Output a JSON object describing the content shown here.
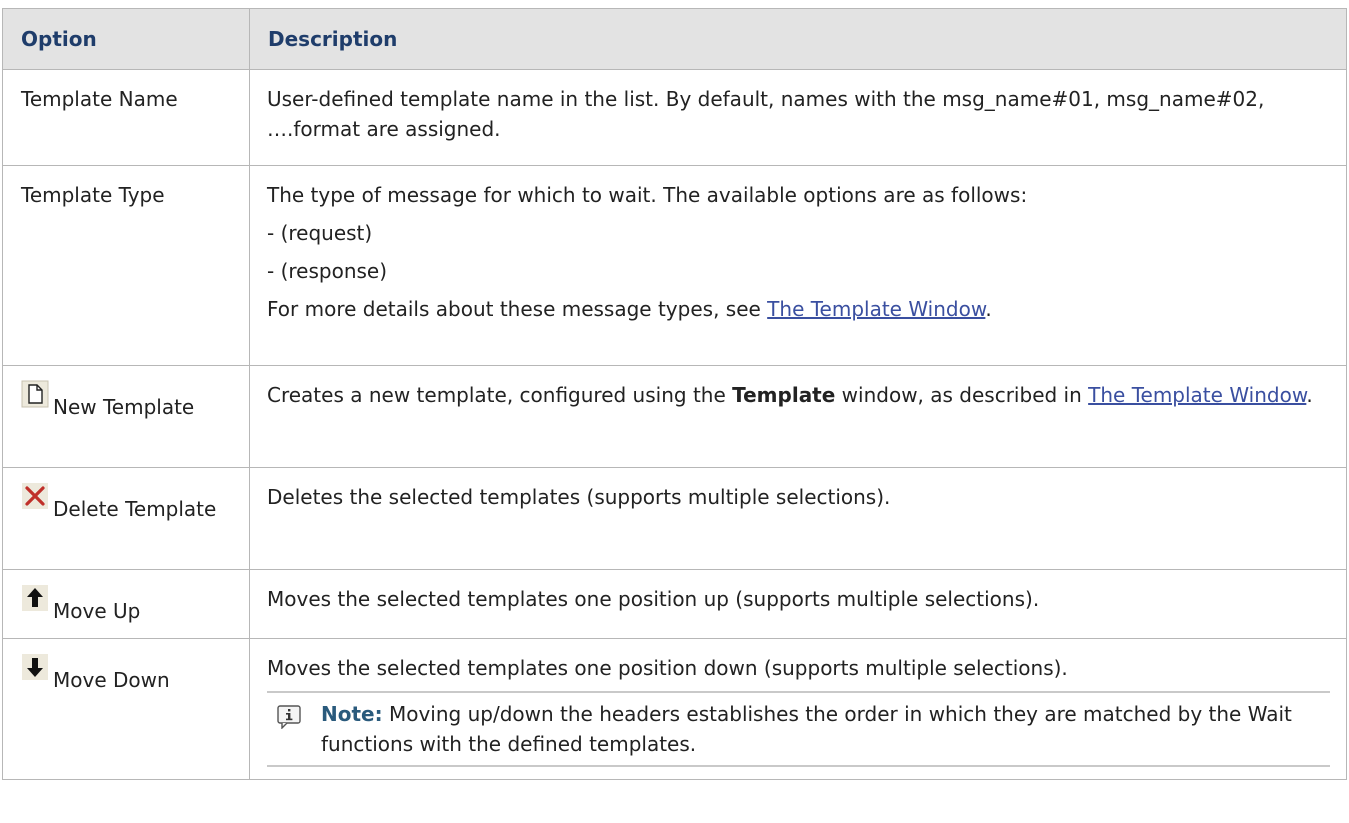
{
  "table": {
    "headers": {
      "option": "Option",
      "description": "Description"
    },
    "rows": [
      {
        "option": "Template Name",
        "desc": [
          "User-defined template name in the list. By default, names with the msg_name#01, msg_name#02, ….format are assigned."
        ]
      },
      {
        "option": "Template Type",
        "desc": [
          "The type of message for which to wait. The available options are as follows:",
          "- (request)",
          "- (response)"
        ],
        "more_prefix": "For more details about these message types, see ",
        "link": "The Template Window",
        "more_suffix": "."
      },
      {
        "icon": "new-document-icon",
        "option": "New Template",
        "desc_prefix": "Creates a new template, configured using the ",
        "desc_bold": "Template",
        "desc_suffix": " window, as described in ",
        "link": "The Template Window",
        "link_suffix": "."
      },
      {
        "icon": "red-x-delete-icon",
        "option": "Delete Template",
        "desc": [
          "Deletes the selected templates (supports multiple selections)."
        ]
      },
      {
        "icon": "up-arrow-icon",
        "option": "Move Up",
        "desc": [
          "Moves the selected templates one position up (supports multiple selections)."
        ]
      },
      {
        "icon": "down-arrow-icon",
        "option": "Move Down",
        "desc": [
          "Moves the selected templates one position down (supports multiple selections)."
        ],
        "note": {
          "icon": "info-note-icon",
          "label": "Note:",
          "text": " Moving up/down the headers establishes the order in which they are matched by the Wait functions with the defined templates."
        }
      }
    ]
  },
  "colors": {
    "header_bg": "#e3e3e3",
    "header_text": "#1f3d6b",
    "link": "#3a4fa0",
    "note_label": "#2a5a7c",
    "delete_icon": "#c0302a"
  }
}
